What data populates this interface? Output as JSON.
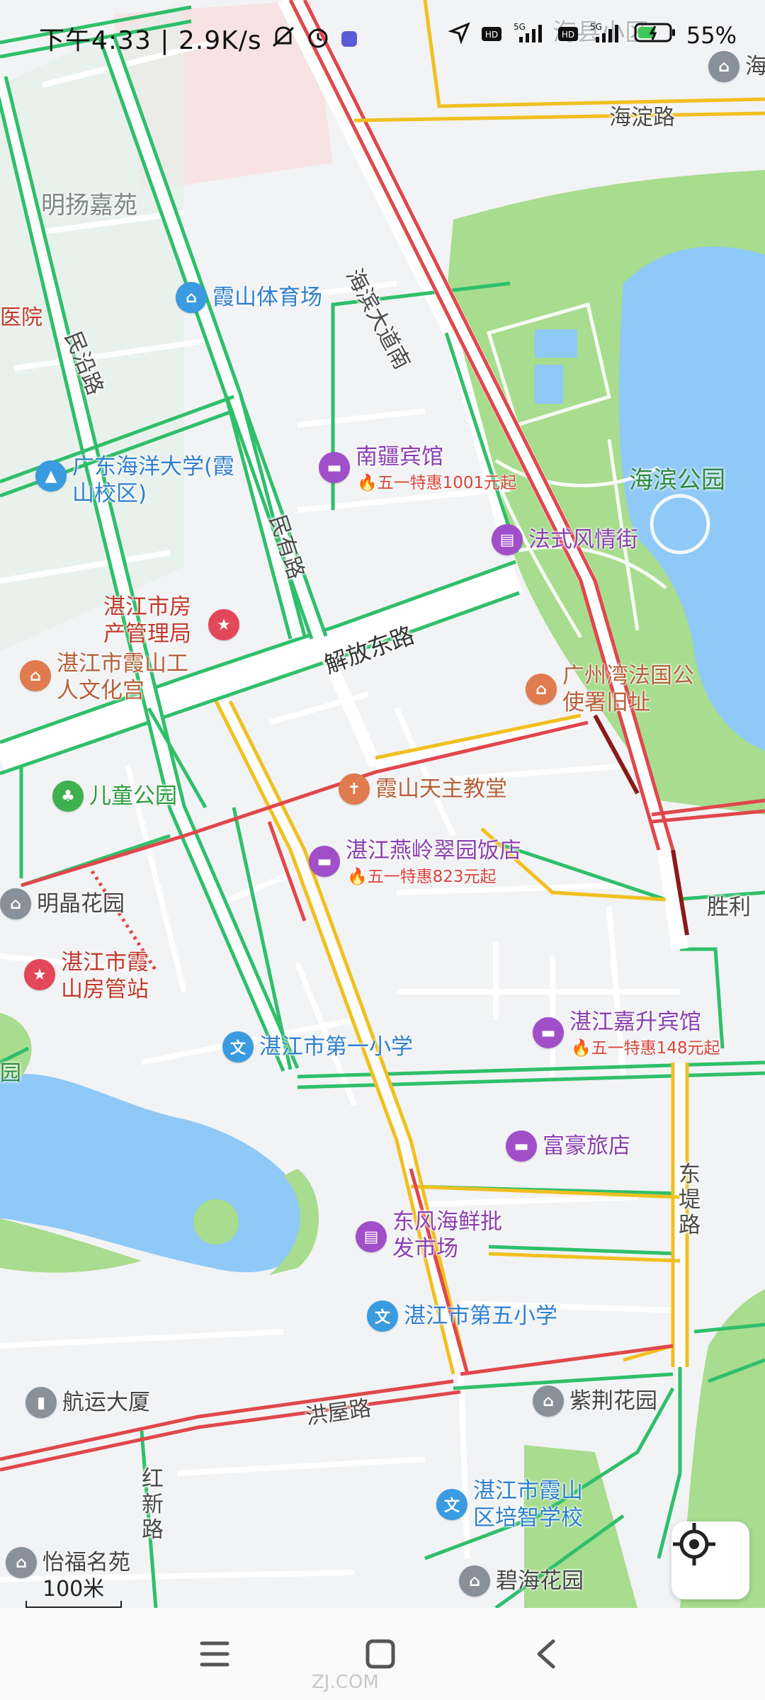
{
  "status_bar": {
    "time": "下午4:33",
    "net_speed": "2.9K/s",
    "battery": "55%",
    "icons": [
      "mute-bell-icon",
      "alarm-icon",
      "sticker-icon",
      "location-arrow-icon",
      "hd-icon",
      "signal-5g-icon",
      "hd-icon",
      "signal-5g-icon",
      "battery-charging-icon"
    ]
  },
  "roads": {
    "haiding": "海淀路",
    "haibin_dadao": "海滨大道南",
    "minyan": "民沿路",
    "minyou": "民有路",
    "jiefang": "解放东路",
    "dongdi": "东堤路",
    "hongwu": "洪屋路",
    "hongxin": "红新路",
    "shengli": "胜利"
  },
  "areas": {
    "mingyang": "明扬嘉苑",
    "haibin_park": "海滨公园",
    "haixian_xiaoqu": "海县小区",
    "yiyuan": "医院",
    "yuan": "园"
  },
  "pois": [
    {
      "name": "霞山体育场",
      "icon": "stadium-icon",
      "color": "#3a9be0",
      "text_color": "#2f7fcf"
    },
    {
      "name": "广东海洋大学(霞山校区)",
      "icon": "school-icon",
      "color": "#3a9be0",
      "text_color": "#2f7fcf"
    },
    {
      "name": "南疆宾馆",
      "sub": "五一特惠1001元起",
      "icon": "hotel-icon",
      "color": "#a14fc9",
      "text_color": "#8a3fb0"
    },
    {
      "name": "法式风情街",
      "icon": "shopping-icon",
      "color": "#a14fc9",
      "text_color": "#8a3fb0"
    },
    {
      "name": "湛江市房产管理局",
      "icon": "government-icon",
      "color": "#e2475a",
      "text_color": "#c0392b"
    },
    {
      "name": "湛江市霞山工人文化宫",
      "icon": "culture-icon",
      "color": "#e07b4f",
      "text_color": "#b5603a"
    },
    {
      "name": "广州湾法国公使署旧址",
      "icon": "landmark-icon",
      "color": "#e07b4f",
      "text_color": "#b5603a"
    },
    {
      "name": "儿童公园",
      "icon": "park-icon",
      "color": "#3cb14e",
      "text_color": "#2f9a3f"
    },
    {
      "name": "霞山天主教堂",
      "icon": "church-icon",
      "color": "#e07b4f",
      "text_color": "#b5603a"
    },
    {
      "name": "湛江燕岭翠园饭店",
      "sub": "五一特惠823元起",
      "icon": "hotel-icon",
      "color": "#a14fc9",
      "text_color": "#8a3fb0"
    },
    {
      "name": "明晶花园",
      "icon": "residential-icon",
      "color": "#8a9099",
      "text_color": "#444"
    },
    {
      "name": "湛江市霞山房管站",
      "icon": "government-icon",
      "color": "#e2475a",
      "text_color": "#c0392b"
    },
    {
      "name": "湛江嘉升宾馆",
      "sub": "五一特惠148元起",
      "icon": "hotel-icon",
      "color": "#a14fc9",
      "text_color": "#8a3fb0"
    },
    {
      "name": "湛江市第一小学",
      "icon": "school-icon",
      "color": "#3a9be0",
      "text_color": "#2f7fcf"
    },
    {
      "name": "富豪旅店",
      "icon": "hotel-icon",
      "color": "#a14fc9",
      "text_color": "#8a3fb0"
    },
    {
      "name": "东风海鲜批发市场",
      "icon": "market-icon",
      "color": "#a14fc9",
      "text_color": "#8a3fb0"
    },
    {
      "name": "湛江市第五小学",
      "icon": "school-icon",
      "color": "#3a9be0",
      "text_color": "#2f7fcf"
    },
    {
      "name": "航运大厦",
      "icon": "building-icon",
      "color": "#8a9099",
      "text_color": "#444"
    },
    {
      "name": "紫荆花园",
      "icon": "residential-icon",
      "color": "#8a9099",
      "text_color": "#444"
    },
    {
      "name": "湛江市霞山区培智学校",
      "icon": "school-icon",
      "color": "#3a9be0",
      "text_color": "#2f7fcf"
    },
    {
      "name": "怡福名苑",
      "icon": "residential-icon",
      "color": "#8a9099",
      "text_color": "#444"
    },
    {
      "name": "碧海花园",
      "icon": "residential-icon",
      "color": "#8a9099",
      "text_color": "#444"
    },
    {
      "name": "海",
      "icon": "residential-icon",
      "color": "#8a9099",
      "text_color": "#444"
    }
  ],
  "scale": {
    "label": "100米"
  },
  "nav": {
    "menu": "menu-icon",
    "home": "home-square-icon",
    "back": "back-chevron-icon"
  },
  "watermark": "ZJ.COM"
}
